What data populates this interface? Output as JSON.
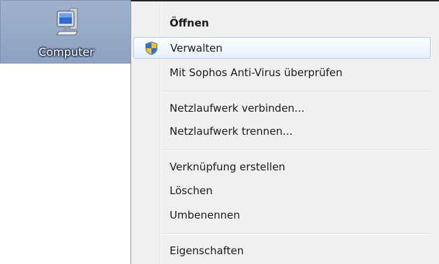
{
  "desktop": {
    "icon_label": "Computer",
    "icon_name": "computer-icon"
  },
  "context_menu": {
    "items": [
      {
        "label": "Öffnen",
        "bold": true
      },
      {
        "label": "Verwalten",
        "icon": "uac-shield-icon",
        "hover": true
      },
      {
        "label": "Mit Sophos Anti-Virus überprüfen"
      },
      {
        "label": "Netzlaufwerk verbinden..."
      },
      {
        "label": "Netzlaufwerk trennen..."
      },
      {
        "label": "Verknüpfung erstellen"
      },
      {
        "label": "Löschen"
      },
      {
        "label": "Umbenennen"
      },
      {
        "label": "Eigenschaften"
      }
    ]
  },
  "colors": {
    "selection_background": "#8ea2c1",
    "menu_background": "#f0f0f0",
    "hover_border": "#aecff7"
  }
}
